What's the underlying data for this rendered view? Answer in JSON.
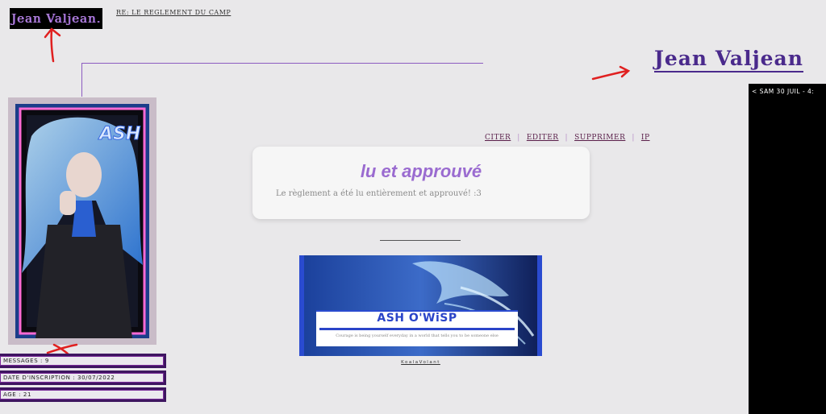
{
  "header": {
    "logo_text": "Jean Valjean.",
    "topic_title": "RE: LE REGLEMENT DU CAMP"
  },
  "user": {
    "username": "Jean Valjean",
    "date": "< SAM 30 JUIL - 4:"
  },
  "profile": {
    "stats": [
      "MESSAGES : 9",
      "DATE D'INSCRIPTION : 30/07/2022",
      "AGE : 21"
    ],
    "avatar_text": "ASH"
  },
  "post": {
    "actions": [
      "CITER",
      "EDITER",
      "SUPPRIMER",
      "IP"
    ],
    "title": "lu et approuvé",
    "body": "Le règlement a été lu entièrement et approuvé! :3"
  },
  "signature": {
    "title": "ASH O'WiSP",
    "tagline": "Courage is being yourself everyday in a world that tells you to be someone else",
    "credit": "KoalaVolant"
  },
  "colors": {
    "accent_purple": "#8c5bc0",
    "username_color": "#4a2a8c",
    "stat_border": "#3e1560",
    "banner_blue": "#2a44c8",
    "annotation_red": "#e02020"
  }
}
